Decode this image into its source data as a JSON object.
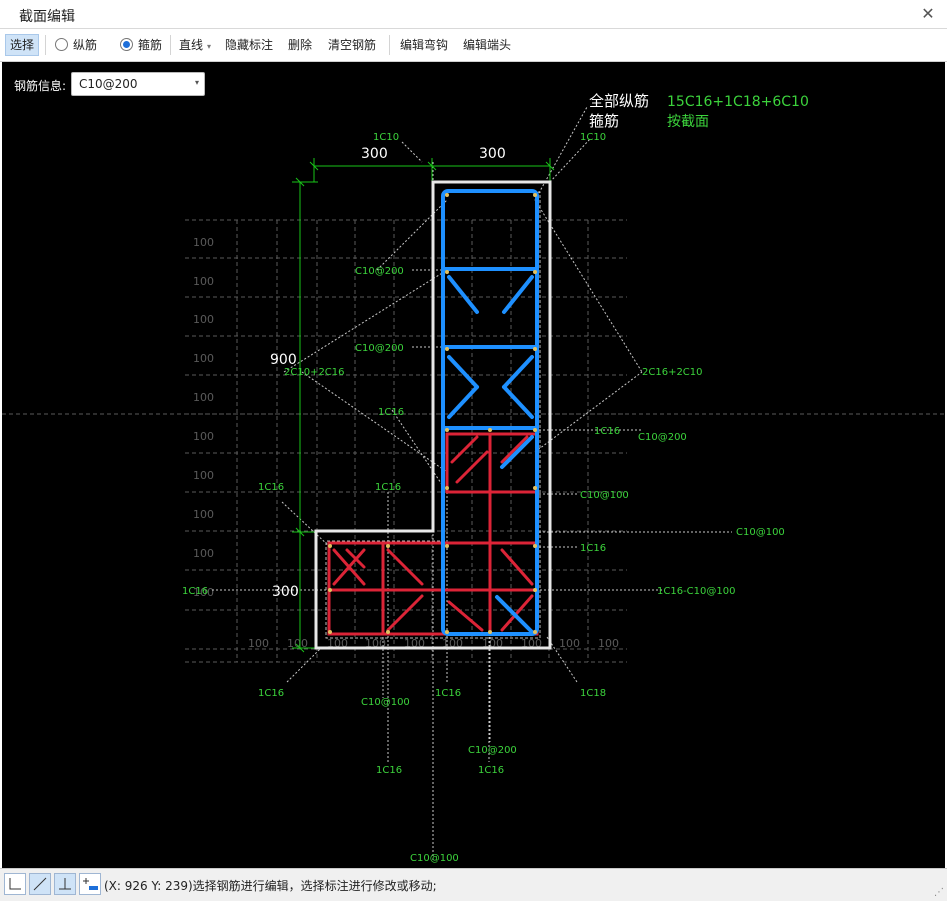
{
  "window": {
    "title": "截面编辑",
    "close_glyph": "✕"
  },
  "toolbar": {
    "select_label": "选择",
    "longitudinal_label": "纵筋",
    "stirrup_label": "箍筋",
    "line_label": "直线",
    "hide_dim_label": "隐藏标注",
    "delete_label": "删除",
    "clear_label": "清空钢筋",
    "edit_hook_label": "编辑弯钩",
    "edit_end_label": "编辑端头"
  },
  "rebar_info": {
    "label": "钢筋信息:",
    "value": "C10@200"
  },
  "summary": {
    "all_long_label": "全部纵筋",
    "all_long_value": "15C16+1C18+6C10",
    "stirrup_label": "箍筋",
    "stirrup_value": "按截面"
  },
  "dims": {
    "top_left": "300",
    "top_right": "300",
    "left_vertical": "900",
    "left_bottom": "300",
    "grid": "100"
  },
  "annotations": {
    "c10_top_a": "1C10",
    "c10_top_b": "1C10",
    "c10_200_1": "C10@200",
    "c10_200_2": "C10@200",
    "c10_200_3": "C10@200",
    "c10_200_4": "C10@200",
    "left_group": "2C10+2C16",
    "right_group": "2C16+2C10",
    "c16_1": "1C16",
    "c16_2": "1C16",
    "c16_3": "1C16",
    "c16_4": "1C16",
    "c16_5": "1C16",
    "c16_6": "1C16",
    "c16_7": "1C16",
    "c16_8": "1C16",
    "c16_9": "1C16",
    "c16_10": "1C16",
    "c18": "1C18",
    "c10_100_1": "C10@100",
    "c10_100_2": "C10@100",
    "c10_100_3": "C10@100",
    "c10_100_4": "C10@100",
    "mixed": "1C16-C10@100"
  },
  "status": {
    "text": "(X: 926 Y: 239)选择钢筋进行编辑，选择标注进行修改或移动;"
  },
  "colors": {
    "canvas": "#000000",
    "outline": "#e8e8e8",
    "blue": "#1e90ff",
    "red": "#dc2437",
    "green": "#3cd33c",
    "dim_green": "#19c419",
    "grid": "#5a5a5a"
  }
}
